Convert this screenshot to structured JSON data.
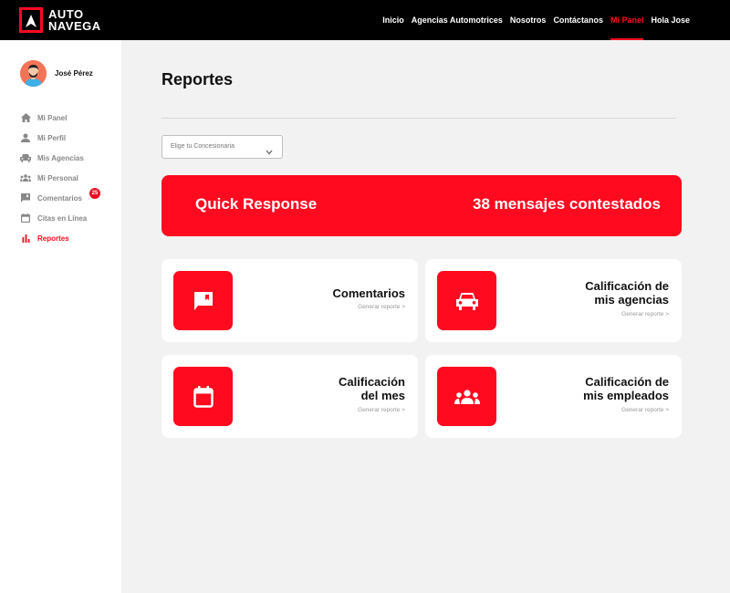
{
  "brand": {
    "line1": "AUTO",
    "line2": "NAVEGA",
    "accent": "#ff0a1f"
  },
  "nav": [
    {
      "label": "Inicio"
    },
    {
      "label": "Agencias Automotrices"
    },
    {
      "label": "Nosotros"
    },
    {
      "label": "Contáctanos"
    },
    {
      "label": "Mi Panel",
      "active": true
    },
    {
      "label": "Hola Jose"
    }
  ],
  "profile": {
    "name": "José Pérez"
  },
  "menu": [
    {
      "label": "Mi Panel",
      "icon": "home-icon"
    },
    {
      "label": "Mi Perfil",
      "icon": "person-icon"
    },
    {
      "label": "Mis Agencias",
      "icon": "car-icon"
    },
    {
      "label": "Mi Personal",
      "icon": "group-icon"
    },
    {
      "label": "Comentarios",
      "icon": "comment-icon",
      "badge": "25"
    },
    {
      "label": "Citas en Línea",
      "icon": "calendar-icon"
    },
    {
      "label": "Reportes",
      "icon": "bar-chart-icon",
      "active": true
    }
  ],
  "main": {
    "title": "Reportes",
    "select_placeholder": "Elige tu Concesionaria",
    "quick": {
      "label": "Quick Response",
      "value": "38 mensajes contestados"
    },
    "cards": [
      {
        "title": "Comentarios",
        "link": "Generar reporte >",
        "icon": "comment-icon"
      },
      {
        "title": "Calificación de\nmis agencias",
        "link": "Generar reporte >",
        "icon": "car-icon"
      },
      {
        "title": "Calificación\ndel mes",
        "link": "Generar reporte >",
        "icon": "calendar-icon"
      },
      {
        "title": "Calificación de\nmis empleados",
        "link": "Generar reporte >",
        "icon": "group-icon"
      }
    ]
  }
}
